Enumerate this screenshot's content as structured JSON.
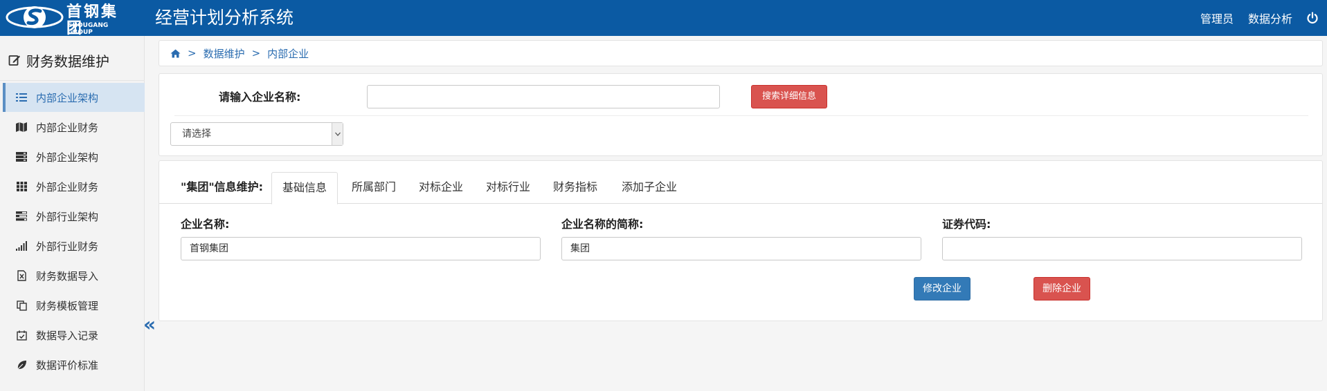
{
  "header": {
    "logo_cn": "首钢集团",
    "logo_en": "SHOUGANG GROUP",
    "app_title": "经营计划分析系统",
    "user_label": "管理员",
    "analysis_label": "数据分析",
    "power_icon": "power-icon",
    "bg_color": "#0b5aa3"
  },
  "sidebar": {
    "title": "财务数据维护",
    "title_icon": "edit-icon",
    "items": [
      {
        "label": "内部企业架构",
        "icon": "list-icon",
        "active": true
      },
      {
        "label": "内部企业财务",
        "icon": "map-icon",
        "active": false
      },
      {
        "label": "外部企业架构",
        "icon": "server-icon",
        "active": false
      },
      {
        "label": "外部企业财务",
        "icon": "grid-icon",
        "active": false
      },
      {
        "label": "外部行业架构",
        "icon": "tasks-icon",
        "active": false
      },
      {
        "label": "外部行业财务",
        "icon": "signal-icon",
        "active": false
      },
      {
        "label": "财务数据导入",
        "icon": "excel-file-icon",
        "active": false
      },
      {
        "label": "财务模板管理",
        "icon": "copy-icon",
        "active": false
      },
      {
        "label": "数据导入记录",
        "icon": "calendar-check-icon",
        "active": false
      },
      {
        "label": "数据评价标准",
        "icon": "leaf-icon",
        "active": false
      }
    ],
    "collapse_glyph": "«"
  },
  "breadcrumb": {
    "home_icon": "home-icon",
    "separator": ">",
    "items": [
      "数据维护",
      "内部企业"
    ]
  },
  "search": {
    "label": "请输入企业名称:",
    "input_value": "",
    "button_label": "搜索详细信息",
    "select_value": "请选择"
  },
  "info": {
    "section_label": "\"集团\"信息维护:",
    "tabs": [
      "基础信息",
      "所属部门",
      "对标企业",
      "对标行业",
      "财务指标",
      "添加子企业"
    ],
    "active_tab": 0,
    "fields": [
      {
        "label": "企业名称:",
        "value": "首钢集团"
      },
      {
        "label": "企业名称的简称:",
        "value": "集团"
      },
      {
        "label": "证券代码:",
        "value": ""
      }
    ],
    "modify_button": "修改企业",
    "delete_button": "删除企业"
  },
  "colors": {
    "primary": "#337ab7",
    "danger": "#d9534f",
    "link": "#2a6cb0"
  }
}
